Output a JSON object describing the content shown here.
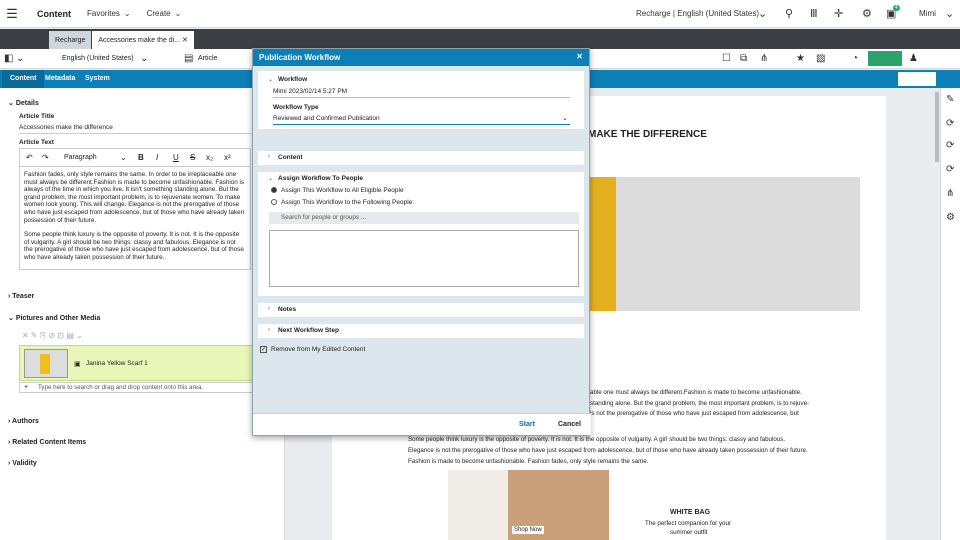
{
  "top": {
    "brand": "Content",
    "menu": [
      "Favorites",
      "Create"
    ],
    "site": "Recharge | English (United States)",
    "user": "Mimi",
    "badge": "4"
  },
  "tabs": [
    "Recharge",
    "Accessories make the di..."
  ],
  "toolbar": {
    "locale": "English (United States)",
    "type": "Article"
  },
  "subtabs": [
    "Content",
    "Metadata",
    "System"
  ],
  "left": {
    "details": "Details",
    "title_label": "Article Title",
    "title_value": "Accessories make the difference",
    "text_label": "Article Text",
    "paragraph": "Paragraph",
    "p1": "Fashion fades, only style remains the same. In order to be irreplaceable one must always be different.Fashion is made to become unfashionable. Fashion is always of the time in which you live. It isn't something standing alone. But the grand problem, the most important problem, is to rejuvenate women. To make women look young. This will change. Elegance is not the prerogative of those who have just escaped from adolescence, but of those who have already taken possession of their future.",
    "p2": "Some people think luxury is the opposite of poverty. It is not. It is the opposite of vulgarity. A girl should be two things: classy and fabulous. Elegance is not the prerogative of those who have just escaped from adolescence, but of those who have already taken possession of their future.",
    "teaser": "Teaser",
    "pictures": "Pictures and Other Media",
    "media_item": "Janina Yellow Scarf 1",
    "media_hint": "Type here to search or drag and drop content onto this area.",
    "authors": "Authors",
    "related": "Related Content Items",
    "validity": "Validity"
  },
  "preview": {
    "heading": "MAKE THE DIFFERENCE",
    "lines": [
      "able one must always be different.Fashion is made to become unfashionable.",
      "standing alone. But the grand problem, the most important problem, is to rejuve-",
      "is not the prerogative of those who have just escaped from adolescence, but"
    ],
    "p2": [
      "Some people think luxury is the opposite of poverty. It is not. It is the opposite of vulgarity. A girl should be two things: classy and fabulous.",
      "Elegance is not the prerogative of those who have just escaped from adolescence, but of those who have already taken possession of their future.",
      "Fashion is made to become unfashionable. Fashion fades, only style remains the same."
    ],
    "bag_title": "WHITE BAG",
    "bag_l1": "The perfect companion for your",
    "bag_l2": "summer outfit",
    "shop": "Shop Now"
  },
  "dialog": {
    "title": "Publication Workflow",
    "workflow": "Workflow",
    "workflow_value": "Mimi 2023/02/14 5:27 PM",
    "type_label": "Workflow Type",
    "type_value": "Reviewed and Confirmed Publication",
    "content": "Content",
    "assign": "Assign Workflow To People",
    "opt1": "Assign This Workflow to All Eligible People",
    "opt2": "Assign This Workflow to the Following People:",
    "search_ph": "Search for people or groups ...",
    "notes": "Notes",
    "next": "Next Workflow Step",
    "remove": "Remove from My Edited Content",
    "start": "Start",
    "cancel": "Cancel"
  }
}
